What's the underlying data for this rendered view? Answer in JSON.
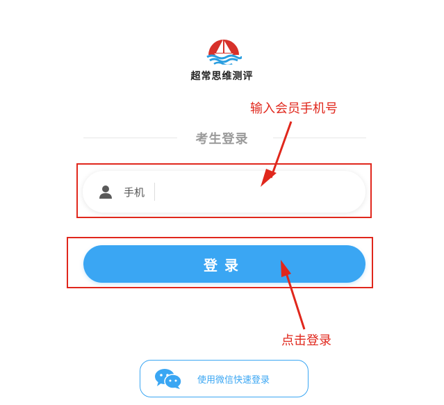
{
  "brand": {
    "name": "超常思维测评"
  },
  "login": {
    "section_title": "考生登录",
    "phone_label": "手机",
    "phone_value": "",
    "phone_placeholder": "",
    "login_label": "登录",
    "wechat_label": "使用微信快速登录"
  },
  "annotations": {
    "phone_hint": "输入会员手机号",
    "login_hint": "点击登录"
  },
  "colors": {
    "accent": "#3aa6f3",
    "annotation": "#e0271c",
    "logo_red": "#d7312a",
    "logo_wave": "#2a9ee0"
  },
  "icons": {
    "logo": "boat-logo-icon",
    "user": "user-icon",
    "wechat": "wechat-icon"
  }
}
